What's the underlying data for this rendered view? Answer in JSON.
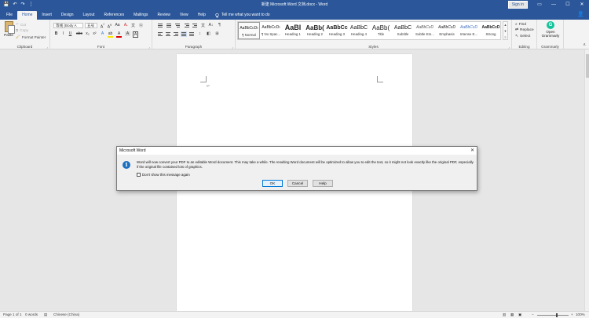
{
  "titlebar": {
    "title": "新建 Microsoft Word 文档.docx  -  Word",
    "signin": "Sign in",
    "qat": {
      "save": "💾",
      "undo": "↶",
      "redo": "↷",
      "more": "⋮"
    },
    "controls": {
      "ribbon": "▭",
      "minimize": "—",
      "maximize": "☐",
      "close": "✕"
    }
  },
  "tabs": [
    "File",
    "Home",
    "Insert",
    "Design",
    "Layout",
    "References",
    "Mailings",
    "Review",
    "View",
    "Help"
  ],
  "tell_me": "Tell me what you want to do",
  "share_icon": "👤",
  "ribbon": {
    "clipboard": {
      "label": "Clipboard",
      "paste": "Paste",
      "cut": "Cut",
      "copy": "Copy",
      "format_painter": "Format Painter"
    },
    "font": {
      "label": "Font",
      "font_name": "等线 (Body A",
      "font_size": "五号",
      "buttons": [
        "B",
        "I",
        "U",
        "abc",
        "x₂",
        "x²"
      ]
    },
    "paragraph": {
      "label": "Paragraph"
    },
    "styles": {
      "label": "Styles",
      "items": [
        {
          "sample": "AaBbCcDı",
          "name": "¶ Normal"
        },
        {
          "sample": "AaBbCcDı",
          "name": "¶ No Spac..."
        },
        {
          "sample": "AaBl",
          "name": "Heading 1"
        },
        {
          "sample": "AaBb(",
          "name": "Heading 2"
        },
        {
          "sample": "AaBbCc",
          "name": "Heading 3"
        },
        {
          "sample": "AaBbC",
          "name": "Heading 4"
        },
        {
          "sample": "AaBb(",
          "name": "Title"
        },
        {
          "sample": "AaBbC",
          "name": "Subtitle"
        },
        {
          "sample": "AaBbCcD",
          "name": "Subtle Em..."
        },
        {
          "sample": "AaBbCcD",
          "name": "Emphasis"
        },
        {
          "sample": "AaBbCcD",
          "name": "Intense E..."
        },
        {
          "sample": "AaBbCcD",
          "name": "Strong"
        }
      ]
    },
    "editing": {
      "label": "Editing",
      "find": "Find",
      "replace": "Replace",
      "select": "Select"
    },
    "grammarly": {
      "label": "Grammarly",
      "button": "Open Grammarly",
      "icon_letter": "G"
    }
  },
  "dialog": {
    "title": "Microsoft Word",
    "message": "Word will now convert your PDF to an editable Word document. This may take a while. The resulting Word document will be optimized to allow you to edit the text, so it might not look exactly like the original PDF, especially if the original file contained lots of graphics.",
    "checkbox_label": "Don't show this message again",
    "ok": "OK",
    "cancel": "Cancel",
    "help": "Help",
    "icon_letter": "i"
  },
  "status": {
    "page": "Page 1 of 1",
    "words": "0 words",
    "language": "Chinese (China)",
    "zoom": "100%",
    "zoom_minus": "−",
    "zoom_plus": "+"
  },
  "colors": {
    "brand": "#2b579a",
    "ribbon_bg": "#f3f3f3",
    "canvas_bg": "#e6e6e6",
    "info_blue": "#1e6fbf",
    "grammarly_green": "#15c39a"
  }
}
